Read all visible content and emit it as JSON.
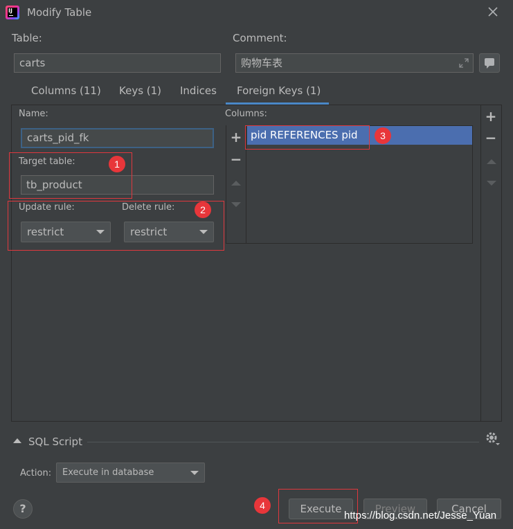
{
  "window": {
    "title": "Modify Table",
    "app_icon_text": "IJ"
  },
  "table_field": {
    "label": "Table:",
    "value": "carts"
  },
  "comment_field": {
    "label": "Comment:",
    "value": "购物车表"
  },
  "tabs": [
    {
      "label": "Columns (11)"
    },
    {
      "label": "Keys (1)"
    },
    {
      "label": "Indices"
    },
    {
      "label": "Foreign Keys (1)",
      "selected": true
    }
  ],
  "fk_form": {
    "name_label": "Name:",
    "name_value": "carts_pid_fk",
    "target_label": "Target table:",
    "target_value": "tb_product",
    "update_label": "Update rule:",
    "update_value": "restrict",
    "delete_label": "Delete rule:",
    "delete_value": "restrict",
    "columns_label": "Columns:",
    "columns": [
      "pid REFERENCES pid"
    ]
  },
  "annotations": {
    "badge1": "1",
    "badge2": "2",
    "badge3": "3",
    "badge4": "4",
    "color": "#e8363a"
  },
  "sql": {
    "section_label": "SQL Script",
    "action_label": "Action:",
    "action_value": "Execute in database"
  },
  "buttons": {
    "help": "?",
    "execute": "Execute",
    "preview": "Preview",
    "cancel": "Cancel"
  },
  "watermark": "https://blog.csdn.net/Jesse_Yuan",
  "colors": {
    "background": "#3c3f41",
    "selection": "#4b6eaf",
    "tab_underline": "#4a88c7",
    "annotation_red": "#e0383e"
  }
}
